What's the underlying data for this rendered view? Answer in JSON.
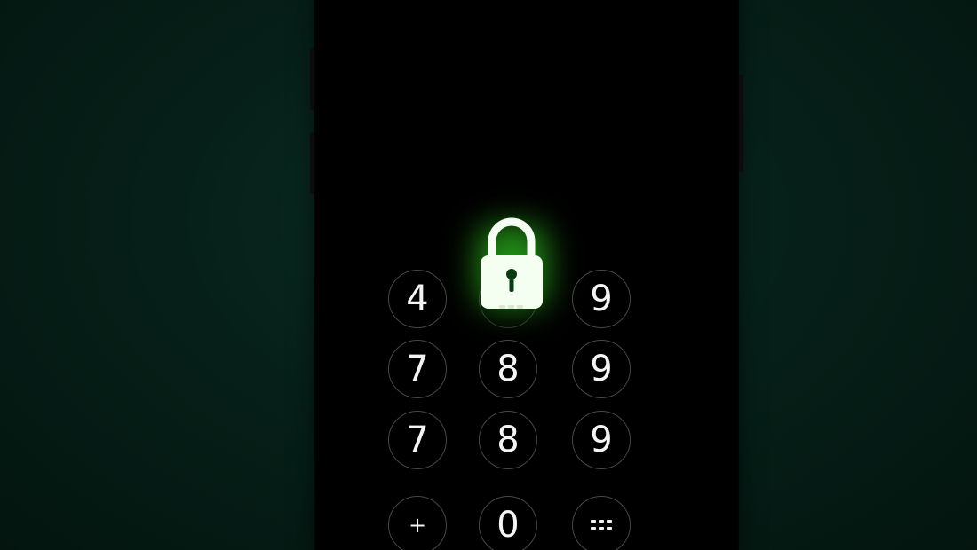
{
  "keypad": {
    "row1": [
      "4",
      "9"
    ],
    "row2": [
      "7",
      "8",
      "9"
    ],
    "row3": [
      "7",
      "8",
      "9"
    ],
    "row4": [
      "+",
      "0"
    ]
  },
  "lock": {
    "icon": "padlock-icon",
    "glow_color": "#3cff28",
    "body_color": "#f4fff2"
  },
  "colors": {
    "background": "#062019",
    "screen": "#000000",
    "key_text": "#f4f4f4"
  }
}
